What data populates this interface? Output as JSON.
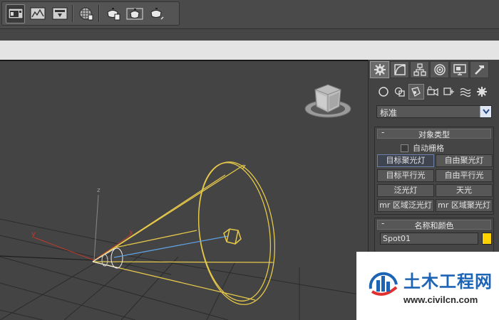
{
  "toolbar": {
    "buttons": [
      "render-setup-icon",
      "rendered-frame-window-icon",
      "render-production-icon",
      "material-editor-icon",
      "render-environment-icon",
      "teapot-render-icon",
      "teapot-iterative-icon"
    ]
  },
  "command_panel": {
    "tabs": [
      "create-tab-icon",
      "modify-tab-icon",
      "hierarchy-tab-icon",
      "motion-tab-icon",
      "display-tab-icon",
      "utilities-tab-icon"
    ],
    "categories": [
      "geometry-icon",
      "shapes-icon",
      "lights-icon",
      "cameras-icon",
      "helpers-icon",
      "space-warps-icon",
      "systems-icon"
    ],
    "dropdown_value": "标准",
    "object_type": {
      "title": "对象类型",
      "auto_grid_label": "自动栅格",
      "buttons": [
        "目标聚光灯",
        "自由聚光灯",
        "目标平行光",
        "自由平行光",
        "泛光灯",
        "天光",
        "mr 区域泛光灯",
        "mr 区域聚光灯"
      ]
    },
    "name_color": {
      "title": "名称和颜色",
      "name_value": "Spot01",
      "color": "#ffd200"
    }
  },
  "viewport": {
    "axis_labels": {
      "z": "z",
      "y": "y",
      "x": "x"
    },
    "light_color": "#e6c84a",
    "target_line_color": "#5fa0e0"
  },
  "watermark": {
    "title": "土木工程网",
    "url": "www.civilcn.com"
  }
}
